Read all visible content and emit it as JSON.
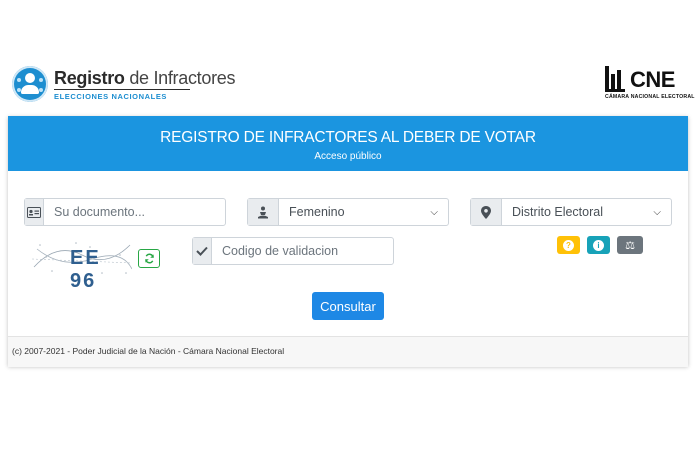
{
  "brand": {
    "title_bold": "Registro",
    "title_rest": " de Infractores",
    "subtitle": "ELECCIONES NACIONALES",
    "accent_color": "#1d8ed0"
  },
  "cne": {
    "logo_text": "CNE",
    "subtitle": "CÁMARA NACIONAL ELECTORAL"
  },
  "header": {
    "title": "REGISTRO DE INFRACTORES AL DEBER DE VOTAR",
    "subtitle": "Acceso público",
    "color": "#1b95e0"
  },
  "form": {
    "document": {
      "placeholder": "Su documento...",
      "value": "",
      "icon": "id-card-icon"
    },
    "gender": {
      "selected": "Femenino",
      "icon": "person-icon"
    },
    "district": {
      "selected": "Distrito Electoral",
      "icon": "map-marker-icon"
    },
    "validation": {
      "placeholder": "Codigo de validacion",
      "value": "",
      "icon": "check-icon"
    },
    "captcha_text": "EE 96",
    "refresh_icon": "refresh-icon",
    "help_buttons": [
      {
        "name": "help-question-button",
        "glyph": "?",
        "color": "#ffc107",
        "icon": "question-icon"
      },
      {
        "name": "help-info-button",
        "glyph": "i",
        "color": "#17a2b8",
        "icon": "info-icon"
      },
      {
        "name": "help-legal-button",
        "glyph": "⚖",
        "color": "#6c757d",
        "icon": "scales-icon"
      }
    ],
    "submit_label": "Consultar"
  },
  "footer": {
    "text": "(c) 2007-2021 - Poder Judicial de la Nación - Cámara Nacional Electoral"
  }
}
